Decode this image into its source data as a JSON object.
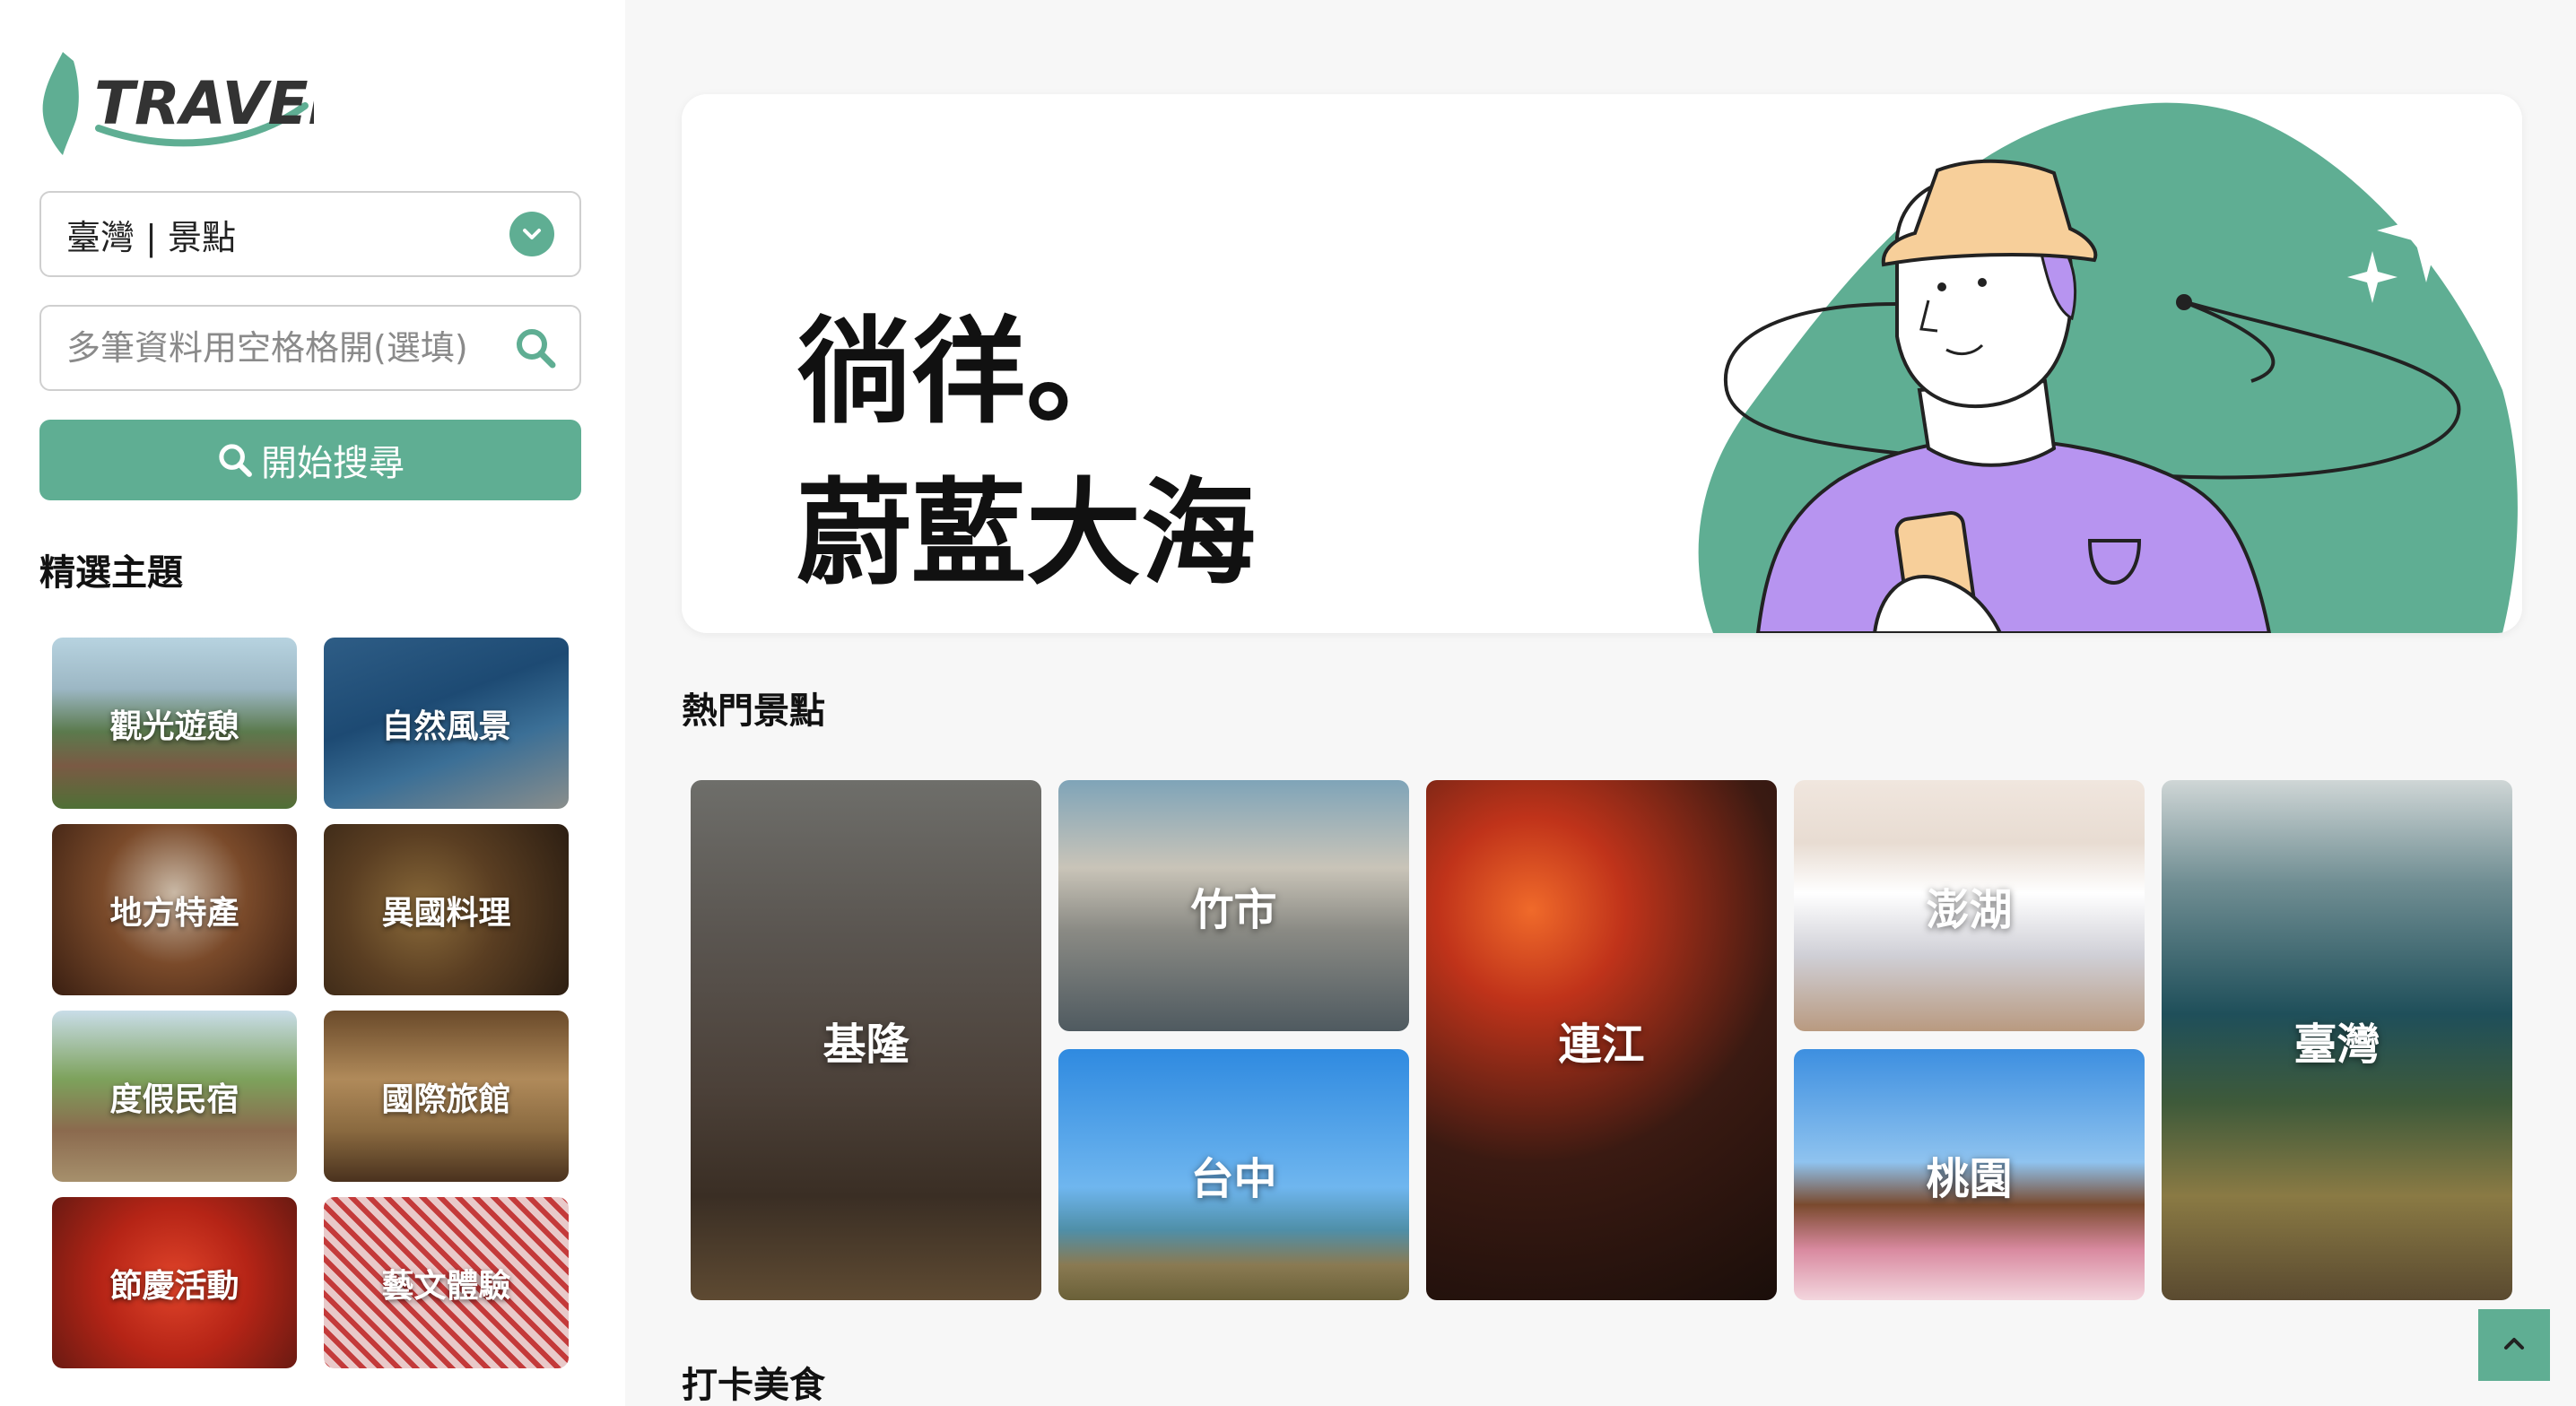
{
  "brand": {
    "logo_text": "TRAVEL"
  },
  "search": {
    "category_value": "臺灣 | 景點",
    "keyword_placeholder": "多筆資料用空格格開(選填)",
    "submit_label": "開始搜尋"
  },
  "themes": {
    "heading": "精選主題",
    "items": [
      {
        "label": "觀光遊憩"
      },
      {
        "label": "自然風景"
      },
      {
        "label": "地方特產"
      },
      {
        "label": "異國料理"
      },
      {
        "label": "度假民宿"
      },
      {
        "label": "國際旅館"
      },
      {
        "label": "節慶活動"
      },
      {
        "label": "藝文體驗"
      }
    ]
  },
  "hero": {
    "line1": "徜徉。",
    "line2": "蔚藍大海"
  },
  "popular": {
    "heading": "熱門景點",
    "items": [
      {
        "label": "基隆"
      },
      {
        "label": "竹市"
      },
      {
        "label": "台中"
      },
      {
        "label": "連江"
      },
      {
        "label": "澎湖"
      },
      {
        "label": "桃園"
      },
      {
        "label": "臺灣"
      }
    ]
  },
  "food": {
    "heading": "打卡美食"
  },
  "colors": {
    "accent": "#5fae93",
    "hero_person_shirt": "#b794f0",
    "hero_hat": "#f7cf9a"
  }
}
